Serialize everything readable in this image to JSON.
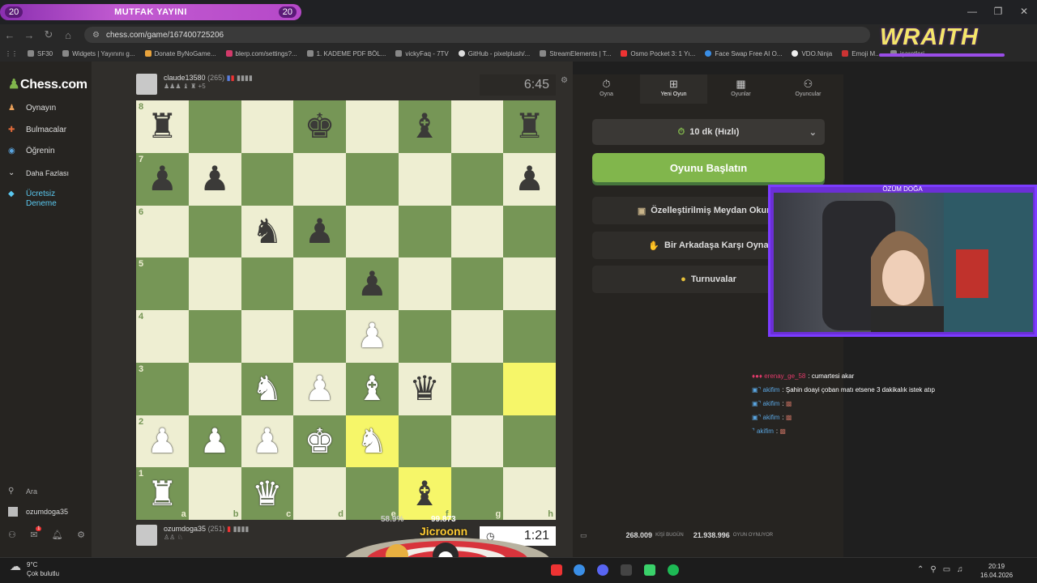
{
  "banner": {
    "left_num": "20",
    "title": "MUTFAK YAYINI",
    "right_num": "20"
  },
  "browser": {
    "url": "chess.com/game/167400725206"
  },
  "bookmarks": [
    "SF30",
    "Widgets | Yayınını g...",
    "Donate ByNoGame...",
    "blerp.com/settings?...",
    "1. KADEME PDF BÖL...",
    "vickyFaq - 7TV",
    "GitHub - pixelplush/...",
    "StreamElements | T...",
    "Osmo Pocket 3: 1 Yı...",
    "Face Swap Free AI O...",
    "VDO.Ninja",
    "Emoji M...",
    "işaretleri"
  ],
  "sidebar": {
    "logo": "Chess.com",
    "items": [
      {
        "label": "Oynayın",
        "icon": "pawn-icon"
      },
      {
        "label": "Bulmacalar",
        "icon": "puzzle-icon"
      },
      {
        "label": "Öğrenin",
        "icon": "learn-icon"
      },
      {
        "label": "Daha Fazlası",
        "icon": "chevron-down-icon"
      },
      {
        "label": "Ücretsiz Deneme",
        "icon": "diamond-icon"
      }
    ],
    "search": "Ara",
    "username": "ozumdoga35",
    "mail_badge": "1"
  },
  "top_player": {
    "name": "claude13580",
    "rating": "(265)",
    "captured": "♟♟♟ ♝ ♜",
    "adv": "+5",
    "clock": "6:45"
  },
  "bottom_player": {
    "name": "ozumdoga35",
    "rating": "(251)",
    "captured": "♙♙ ♘",
    "clock": "1:21"
  },
  "board": {
    "rows": [
      [
        "br",
        "",
        "",
        "bk",
        "",
        "bb",
        "",
        "br"
      ],
      [
        "bp",
        "bp",
        "",
        "",
        "",
        "",
        "",
        "bp"
      ],
      [
        "",
        "",
        "bn",
        "bp",
        "",
        "",
        "",
        ""
      ],
      [
        "",
        "",
        "",
        "",
        "bp",
        "",
        "",
        ""
      ],
      [
        "",
        "",
        "",
        "",
        "wp",
        "",
        "",
        ""
      ],
      [
        "",
        "",
        "wn",
        "wp",
        "wb",
        "bq",
        "",
        ""
      ],
      [
        "wp",
        "wp",
        "wp",
        "wk",
        "wn",
        "",
        "",
        ""
      ],
      [
        "wr",
        "",
        "wq",
        "",
        "",
        "bb",
        "",
        ""
      ]
    ],
    "highlights": [
      "h3",
      "e2",
      "f1"
    ],
    "ranks": [
      "8",
      "7",
      "6",
      "5",
      "4",
      "3",
      "2",
      "1"
    ],
    "files": [
      "a",
      "b",
      "c",
      "d",
      "e",
      "f",
      "g",
      "h"
    ]
  },
  "right_panel": {
    "tabs": [
      {
        "label": "Oyna",
        "icon": "stopwatch-icon"
      },
      {
        "label": "Yeni Oyun",
        "icon": "plus-icon"
      },
      {
        "label": "Oyunlar",
        "icon": "board-icon"
      },
      {
        "label": "Oyuncular",
        "icon": "players-icon"
      }
    ],
    "time_control": "10 dk (Hızlı)",
    "play_button": "Oyunu Başlatın",
    "options": [
      "Özelleştirilmiş Meydan Okuma",
      "Bir Arkadaşa Karşı Oyna",
      "Turnuvalar"
    ],
    "stats": {
      "players_today": "268.009",
      "players_today_label": "KİŞİ BUGÜN",
      "games": "21.938.996",
      "games_label": "OYUN OYNUYOR"
    }
  },
  "overlay": {
    "logo": "WRAITH",
    "cam_name": "ÖZÜM DOĞA",
    "alert_num1": "58.9%",
    "alert_num2": "99.873",
    "alert_name": "Jicroonn"
  },
  "chat": [
    {
      "user": "erenay_ge_58",
      "msg": ": cumartesi akar"
    },
    {
      "user": "akifim",
      "msg": ": Şahin doayi çoban matı etsene 3 dakikalık istek atıp"
    },
    {
      "user": "akifim",
      "msg": ":"
    },
    {
      "user": "akifim",
      "msg": ":"
    },
    {
      "user": "akifim",
      "msg": ":"
    }
  ],
  "taskbar": {
    "temp": "9°C",
    "weather": "Çok bulutlu",
    "time": "20:19",
    "date": "16.04.2026"
  },
  "colors": {
    "board_light": "#eeeed2",
    "board_dark": "#769656",
    "accent_green": "#81b64c",
    "overlay_purple": "#7b3cff"
  }
}
